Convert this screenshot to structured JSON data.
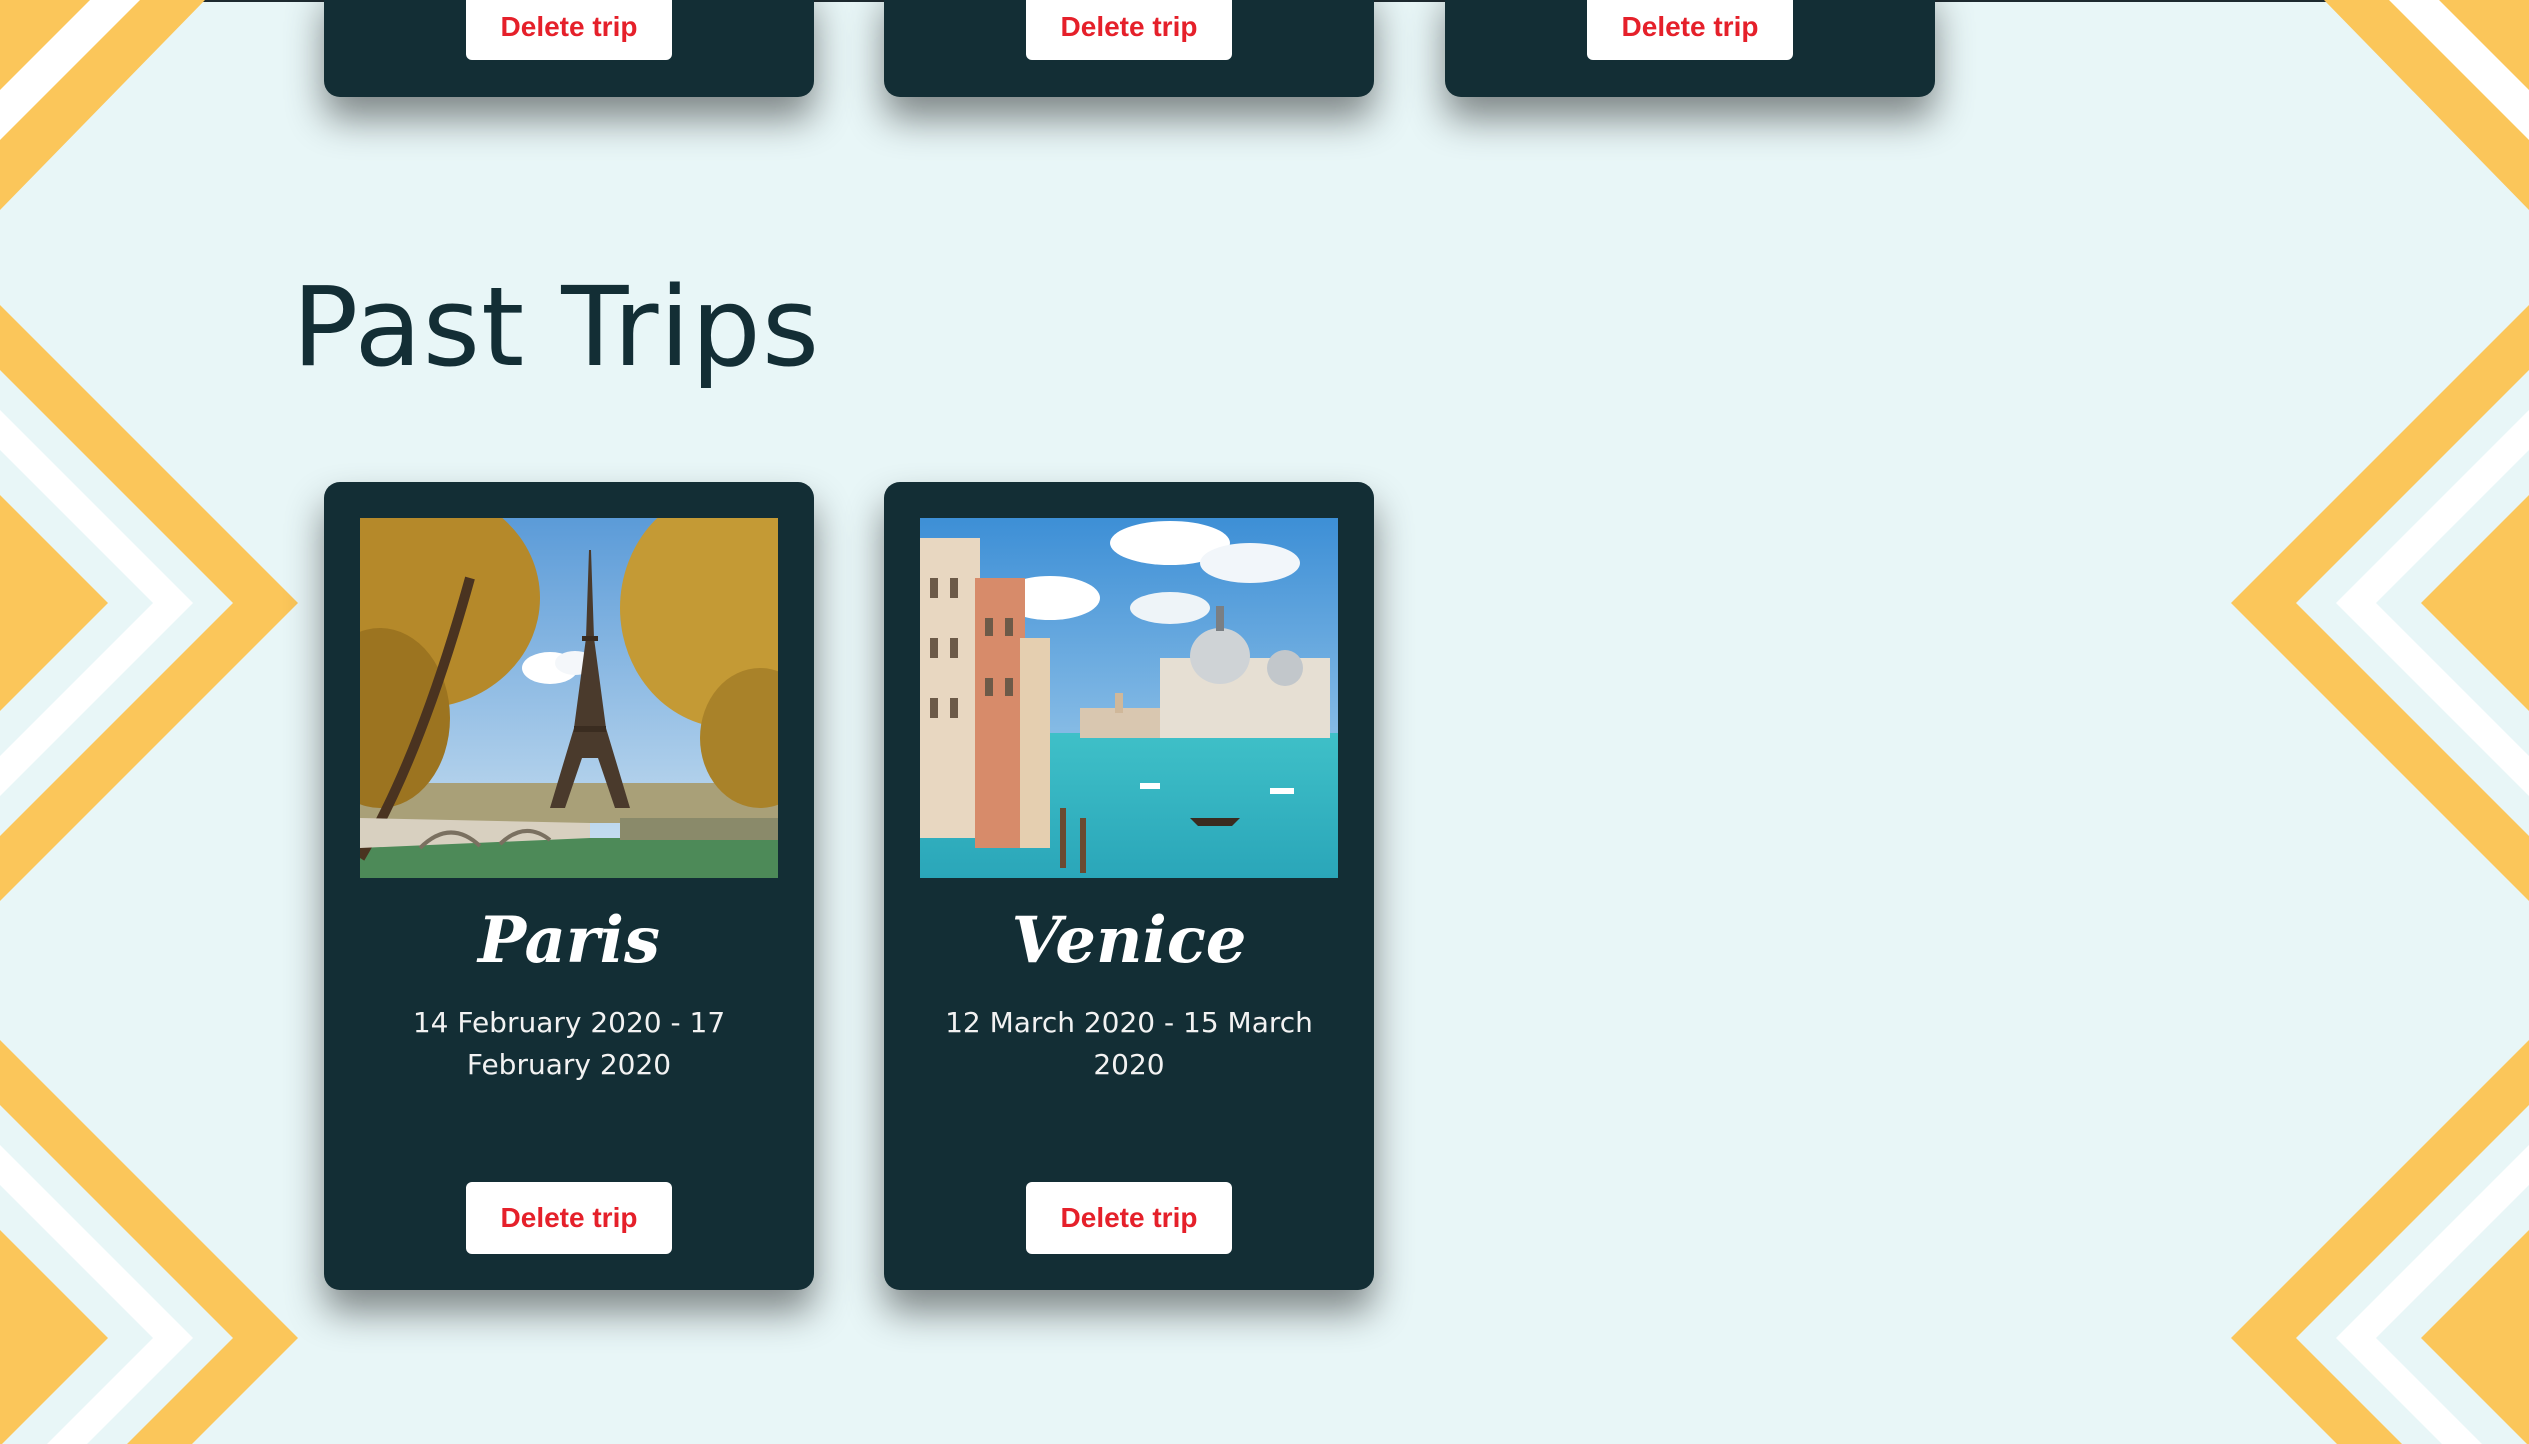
{
  "colors": {
    "background": "#e8f6f7",
    "card": "#132e35",
    "accent_yellow": "#fbc65a",
    "button_text": "#e5202a",
    "title": "#132e35"
  },
  "upcoming_cards": [
    {
      "delete_label": "Delete trip"
    },
    {
      "delete_label": "Delete trip"
    },
    {
      "delete_label": "Delete trip"
    }
  ],
  "past_trips": {
    "title": "Past Trips",
    "trips": [
      {
        "city": "Paris",
        "dates": "14 February 2020 - 17 February 2020",
        "photo": "eiffel-tower-photo",
        "delete_label": "Delete trip"
      },
      {
        "city": "Venice",
        "dates": "12 March 2020 - 15 March 2020",
        "photo": "venice-grand-canal-photo",
        "delete_label": "Delete trip"
      }
    ]
  }
}
